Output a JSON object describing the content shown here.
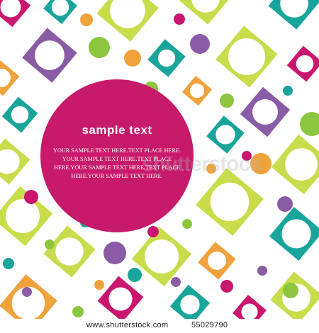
{
  "card": {
    "headline": "sample text",
    "body_lines": [
      "YOUR SAMPLE TEXT HERE.TEXT PLACE HERE.",
      "YOUR SAMPLE TEXT HERE.TEXT PLACE",
      "HERE.YOUR SAMPLE TEXT HERE.TEXT PLACE",
      "HERE.YOUR SAMPLE TEXT HERE."
    ]
  },
  "footer": {
    "site": "www.shutterstock.com",
    "id": "55029790"
  },
  "watermark": {
    "text": "shutterstock"
  },
  "colors": {
    "magenta": "#c8176e",
    "teal": "#1aa59c",
    "lime": "#c9dc4c",
    "purple": "#8a5ca6",
    "orange": "#f0a23c",
    "green": "#8cc63f",
    "pink_circle": "#c81a6a"
  }
}
